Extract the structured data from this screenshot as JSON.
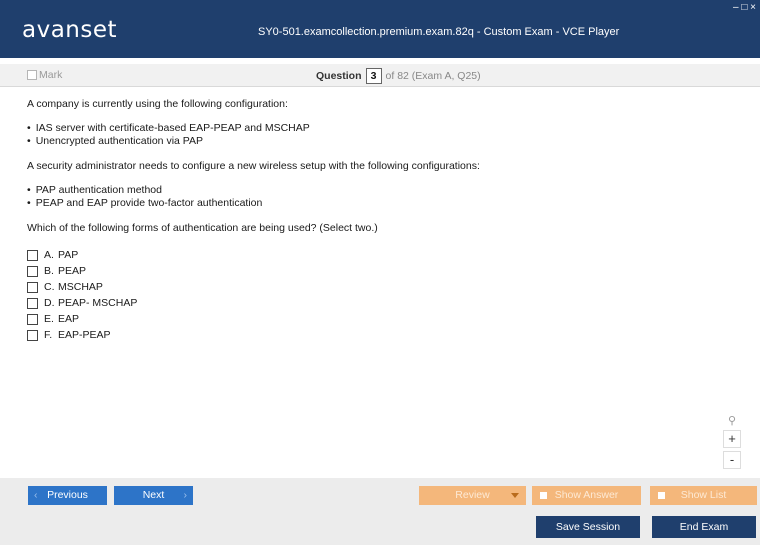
{
  "window": {
    "logo": "avanset",
    "title": "SY0-501.examcollection.premium.exam.82q - Custom Exam - VCE Player",
    "controls": "– □ ×"
  },
  "question_bar": {
    "mark_label": "Mark",
    "question_word": "Question",
    "current": "3",
    "of_text": "of 82 (Exam A, Q25)"
  },
  "question": {
    "intro": "A company is currently using the following configuration:",
    "current_config": [
      "IAS server with certificate-based EAP-PEAP and MSCHAP",
      "Unencrypted authentication via PAP"
    ],
    "need": "A security administrator needs to configure a new wireless setup with the following configurations:",
    "new_config": [
      "PAP authentication method",
      "PEAP and EAP provide two-factor authentication"
    ],
    "prompt": "Which of the following forms of authentication are being used? (Select two.)",
    "options": [
      {
        "letter": "A.",
        "text": "PAP"
      },
      {
        "letter": "B.",
        "text": "PEAP"
      },
      {
        "letter": "C.",
        "text": "MSCHAP"
      },
      {
        "letter": "D.",
        "text": "PEAP- MSCHAP"
      },
      {
        "letter": "E.",
        "text": "EAP"
      },
      {
        "letter": "F.",
        "text": "EAP-PEAP"
      }
    ]
  },
  "zoom": {
    "in": "+",
    "out": "-"
  },
  "footer": {
    "previous": "Previous",
    "next": "Next",
    "review": "Review",
    "show_answer": "Show Answer",
    "show_list": "Show List",
    "save_session": "Save Session",
    "end_exam": "End Exam"
  },
  "colors": {
    "title_bar": "#1f3f6d",
    "nav_button": "#2d74c8",
    "review_button": "#f4b77b"
  }
}
